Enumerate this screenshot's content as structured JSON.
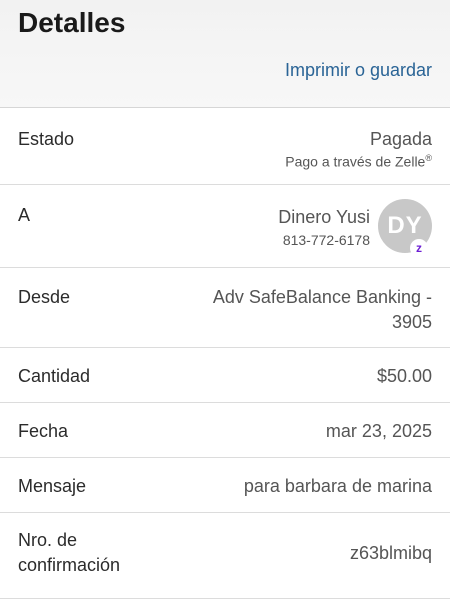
{
  "header": {
    "title": "Detalles",
    "print_label": "Imprimir o guardar"
  },
  "rows": {
    "status": {
      "label": "Estado",
      "value": "Pagada",
      "sub": "Pago a través de Zelle",
      "sub_mark": "®"
    },
    "to": {
      "label": "A",
      "name": "Dinero Yusi",
      "phone": "813-772-6178",
      "initials": "DY",
      "badge": "z"
    },
    "from": {
      "label": "Desde",
      "value_line1": "Adv SafeBalance Banking -",
      "value_line2": "3905"
    },
    "amount": {
      "label": "Cantidad",
      "value": "$50.00"
    },
    "date": {
      "label": "Fecha",
      "value": "mar 23, 2025"
    },
    "message": {
      "label": "Mensaje",
      "value": "para barbara de marina"
    },
    "confirmation": {
      "label_line1": "Nro. de",
      "label_line2": "confirmación",
      "value": "z63blmibq"
    }
  },
  "colors": {
    "link": "#2a6496",
    "zelle_purple": "#6d1ed4",
    "avatar_bg": "#c8c8c8"
  }
}
